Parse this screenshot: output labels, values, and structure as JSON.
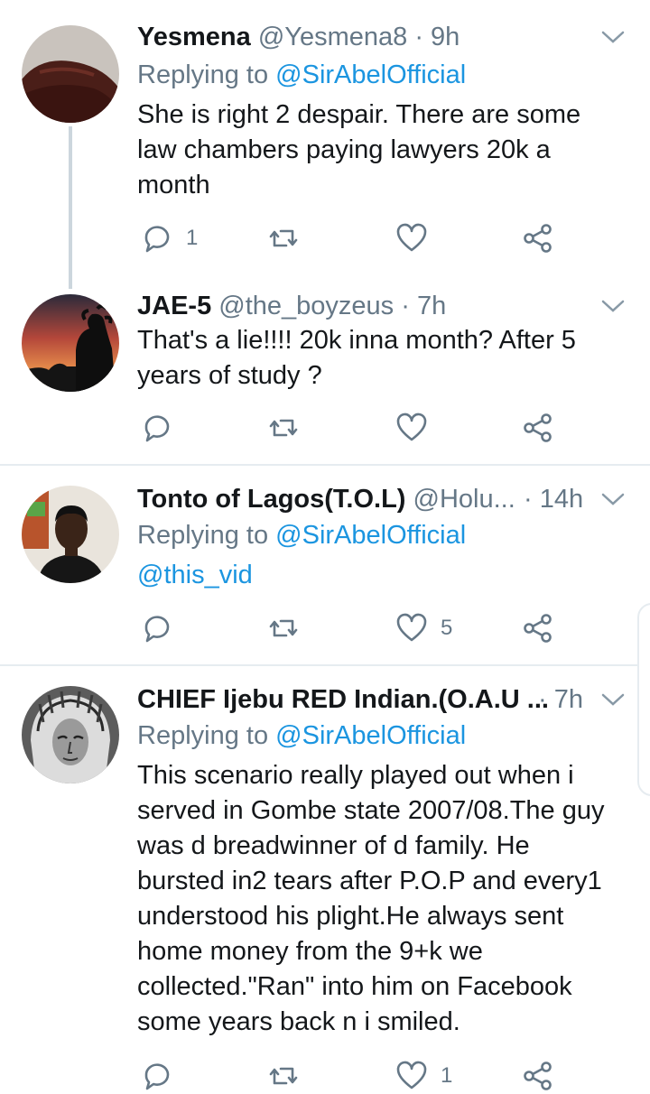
{
  "tweets": [
    {
      "name": "Yesmena",
      "handle": "@Yesmena8",
      "time": "· 9h",
      "replying_prefix": "Replying to",
      "replying_to": "@SirAbelOfficial",
      "text_lines": [
        "She is right 2 despair. There are some",
        "law chambers paying lawyers 20k a",
        "month"
      ],
      "reply_count": "1",
      "retweet_count": "",
      "like_count": ""
    },
    {
      "name": "JAE-5",
      "handle": "@the_boyzeus",
      "time": "· 7h",
      "text_lines": [
        "That's a lie!!!! 20k inna month? After 5",
        "years of study ?"
      ],
      "reply_count": "",
      "retweet_count": "",
      "like_count": ""
    },
    {
      "name": "Tonto of Lagos(T.O.L)",
      "handle": "@Holu...",
      "time": "· 14h",
      "replying_prefix": "Replying to",
      "replying_to": "@SirAbelOfficial",
      "text_lines": [
        "@this_vid"
      ],
      "reply_count": "",
      "retweet_count": "",
      "like_count": "5"
    },
    {
      "name": "CHIEF Ijebu RED Indian.(O.A.U ...",
      "handle": "",
      "time": "· 7h",
      "replying_prefix": "Replying to",
      "replying_to": "@SirAbelOfficial",
      "text_lines": [
        "This scenario really played out when i",
        "served in Gombe state 2007/08.The guy",
        "was d breadwinner of d family. He",
        "bursted in2 tears after P.O.P and every1",
        "understood his plight.He always sent",
        "home money from the 9+k we",
        "collected.\"Ran\" into him on Facebook",
        "some years back n i smiled."
      ],
      "reply_count": "",
      "retweet_count": "",
      "like_count": "1"
    }
  ],
  "icons": {
    "reply": "speech-bubble-icon",
    "retweet": "retweet-icon",
    "like": "heart-icon",
    "share": "share-icon",
    "menu": "chevron-down-icon"
  },
  "colors": {
    "link": "#1b95e0",
    "muted": "#657786",
    "divider": "#e6ecf0"
  }
}
